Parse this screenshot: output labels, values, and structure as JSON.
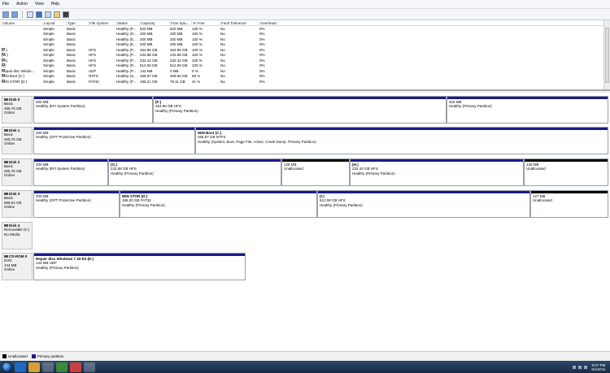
{
  "menu": [
    "File",
    "Action",
    "View",
    "Help"
  ],
  "columns": [
    "Volume",
    "Layout",
    "Type",
    "File System",
    "Status",
    "Capacity",
    "Free Spa...",
    "% Free",
    "Fault Tolerance",
    "Overhead"
  ],
  "volumes": [
    {
      "volume": "",
      "layout": "Simple",
      "type": "Basic",
      "fs": "",
      "status": "Healthy (P...",
      "capacity": "620 MB",
      "free": "620 MB",
      "pct": "100 %",
      "fault": "No",
      "overhead": "0%"
    },
    {
      "volume": "",
      "layout": "Simple",
      "type": "Basic",
      "fs": "",
      "status": "Healthy (G...",
      "capacity": "200 MB",
      "free": "200 MB",
      "pct": "100 %",
      "fault": "No",
      "overhead": "0%"
    },
    {
      "volume": "",
      "layout": "Simple",
      "type": "Basic",
      "fs": "",
      "status": "Healthy (E...",
      "capacity": "200 MB",
      "free": "200 MB",
      "pct": "100 %",
      "fault": "No",
      "overhead": "0%"
    },
    {
      "volume": "",
      "layout": "Simple",
      "type": "Basic",
      "fs": "",
      "status": "Healthy (E...",
      "capacity": "200 MB",
      "free": "200 MB",
      "pct": "100 %",
      "fault": "No",
      "overhead": "0%"
    },
    {
      "volume": "(F:)",
      "layout": "Simple",
      "type": "Basic",
      "fs": "HFS",
      "status": "Healthy (P...",
      "capacity": "464.96 GB",
      "free": "464.96 GB",
      "pct": "100 %",
      "fault": "No",
      "overhead": "0%"
    },
    {
      "volume": "(G:)",
      "layout": "Simple",
      "type": "Basic",
      "fs": "HFS",
      "status": "Healthy (P...",
      "capacity": "232.88 GB",
      "free": "232.88 GB",
      "pct": "100 %",
      "fault": "No",
      "overhead": "0%"
    },
    {
      "volume": "(H:)",
      "layout": "Simple",
      "type": "Basic",
      "fs": "HFS",
      "status": "Healthy (P...",
      "capacity": "232.44 GB",
      "free": "232.44 GB",
      "pct": "100 %",
      "fault": "No",
      "overhead": "0%"
    },
    {
      "volume": "(I:)",
      "layout": "Simple",
      "type": "Basic",
      "fs": "HFS",
      "status": "Healthy (P...",
      "capacity": "512.08 GB",
      "free": "512.08 GB",
      "pct": "100 %",
      "fault": "No",
      "overhead": "0%"
    },
    {
      "volume": "Repair disc Windo...",
      "layout": "Simple",
      "type": "Basic",
      "fs": "UDF",
      "status": "Healthy (P...",
      "capacity": "142 MB",
      "free": "0 MB",
      "pct": "0 %",
      "fault": "No",
      "overhead": "0%"
    },
    {
      "volume": "WIN Boot (C:)",
      "layout": "Simple",
      "type": "Basic",
      "fs": "NTFS",
      "status": "Healthy (S...",
      "capacity": "465.57 GB",
      "free": "409.66 GB",
      "pct": "88 %",
      "fault": "No",
      "overhead": "0%"
    },
    {
      "volume": "WIN STOR (D:)",
      "layout": "Simple",
      "type": "Basic",
      "fs": "FAT32",
      "status": "Healthy (P...",
      "capacity": "186.21 GB",
      "free": "76.11 GB",
      "pct": "41 %",
      "fault": "No",
      "overhead": "0%"
    }
  ],
  "disks": [
    {
      "name": "Disk 0",
      "type": "Basic",
      "size": "465.76 GB",
      "state": "Online",
      "parts": [
        {
          "name": "",
          "size": "200 MB",
          "status": "Healthy (EFI System Partition)",
          "unalloc": false
        },
        {
          "name": "(F:)",
          "size": "464.96 GB HFS",
          "status": "Healthy (Primary Partition)",
          "unalloc": false
        },
        {
          "name": "",
          "size": "620 MB",
          "status": "Healthy (Primary Partition)",
          "unalloc": false
        }
      ]
    },
    {
      "name": "Disk 1",
      "type": "Basic",
      "size": "465.76 GB",
      "state": "Online",
      "parts": [
        {
          "name": "",
          "size": "200 MB",
          "status": "Healthy (GPT Protective Partition)",
          "unalloc": false
        },
        {
          "name": "WIN Boot (C:)",
          "size": "465.57 GB NTFS",
          "status": "Healthy (System, Boot, Page File, Active, Crash Dump, Primary Partition)",
          "unalloc": false
        }
      ]
    },
    {
      "name": "Disk 2",
      "type": "Basic",
      "size": "465.76 GB",
      "state": "Online",
      "parts": [
        {
          "name": "",
          "size": "200 MB",
          "status": "Healthy (EFI System Partition)",
          "unalloc": false
        },
        {
          "name": "(G:)",
          "size": "232.88 GB HFS",
          "status": "Healthy (Primary Partition)",
          "unalloc": false
        },
        {
          "name": "",
          "size": "128 MB",
          "status": "Unallocated",
          "unalloc": true
        },
        {
          "name": "(H:)",
          "size": "232.44 GB HFS",
          "status": "Healthy (Primary Partition)",
          "unalloc": false
        },
        {
          "name": "",
          "size": "128 MB",
          "status": "Unallocated",
          "unalloc": true
        }
      ]
    },
    {
      "name": "Disk 3",
      "type": "Basic",
      "size": "698.64 GB",
      "state": "Online",
      "parts": [
        {
          "name": "",
          "size": "200 MB",
          "status": "Healthy (GPT Protective Partition)",
          "unalloc": false
        },
        {
          "name": "WIN STOR (D:)",
          "size": "186.20 GB FAT32",
          "status": "Healthy (Primary Partition)",
          "unalloc": false
        },
        {
          "name": "(I:)",
          "size": "512.08 GB HFS",
          "status": "Healthy (Primary Partition)",
          "unalloc": false
        },
        {
          "name": "",
          "size": "127 MB",
          "status": "Unallocated",
          "unalloc": true
        }
      ]
    },
    {
      "name": "Disk 4",
      "type": "Removable (K:)",
      "size": "",
      "state": "No Media",
      "parts": []
    },
    {
      "name": "CD-ROM 0",
      "type": "DVD",
      "size": "144 MB",
      "state": "Online",
      "parts": [
        {
          "name": "Repair disc Windows 7 32-bit (E:)",
          "size": "144 MB UDF",
          "status": "Healthy (Primary Partition)",
          "unalloc": false
        }
      ]
    }
  ],
  "legend": {
    "unallocated": "Unallocated",
    "primary": "Primary partition"
  },
  "clock": {
    "time": "6:07 PM",
    "date": "5/1/2011"
  }
}
